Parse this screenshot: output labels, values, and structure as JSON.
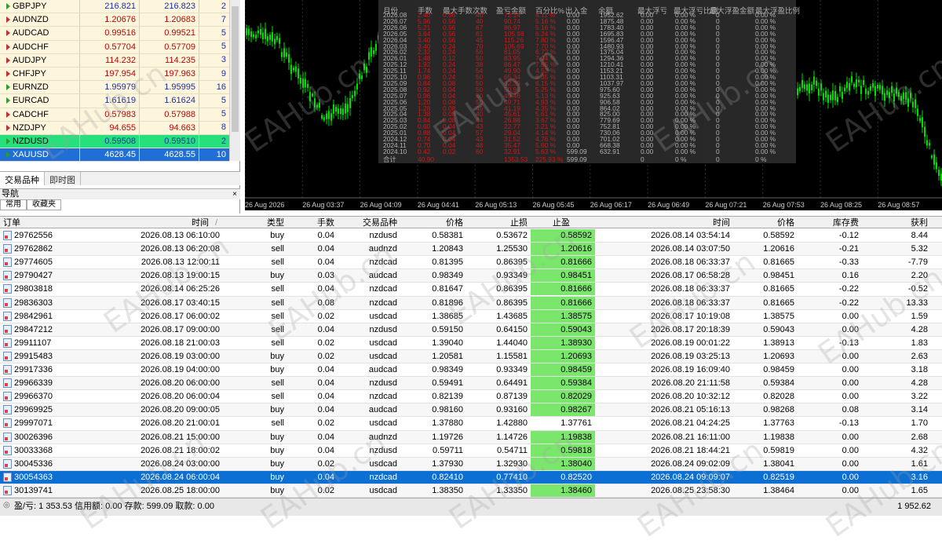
{
  "market_watch": {
    "rows": [
      {
        "symbol": "GBPJPY",
        "bid": "216.821",
        "ask": "216.823",
        "spread": "2",
        "style": "normal",
        "dir": "up"
      },
      {
        "symbol": "AUDNZD",
        "bid": "1.20676",
        "ask": "1.20683",
        "spread": "7",
        "style": "normal",
        "dir": "down"
      },
      {
        "symbol": "AUDCAD",
        "bid": "0.99516",
        "ask": "0.99521",
        "spread": "5",
        "style": "normal",
        "dir": "down"
      },
      {
        "symbol": "AUDCHF",
        "bid": "0.57704",
        "ask": "0.57709",
        "spread": "5",
        "style": "normal",
        "dir": "down"
      },
      {
        "symbol": "AUDJPY",
        "bid": "114.232",
        "ask": "114.235",
        "spread": "3",
        "style": "normal",
        "dir": "down"
      },
      {
        "symbol": "CHFJPY",
        "bid": "197.954",
        "ask": "197.963",
        "spread": "9",
        "style": "normal",
        "dir": "down"
      },
      {
        "symbol": "EURNZD",
        "bid": "1.95979",
        "ask": "1.95995",
        "spread": "16",
        "style": "normal",
        "dir": "up"
      },
      {
        "symbol": "EURCAD",
        "bid": "1.61619",
        "ask": "1.61624",
        "spread": "5",
        "style": "normal",
        "dir": "up"
      },
      {
        "symbol": "CADCHF",
        "bid": "0.57983",
        "ask": "0.57988",
        "spread": "5",
        "style": "normal",
        "dir": "down"
      },
      {
        "symbol": "NZDJPY",
        "bid": "94.655",
        "ask": "94.663",
        "spread": "8",
        "style": "normal",
        "dir": "down"
      },
      {
        "symbol": "NZDUSD",
        "bid": "0.59508",
        "ask": "0.59510",
        "spread": "2",
        "style": "green",
        "dir": "up"
      },
      {
        "symbol": "XAUUSD",
        "bid": "4628.45",
        "ask": "4628.55",
        "spread": "10",
        "style": "blue",
        "dir": "up"
      }
    ],
    "tabs": [
      "交易品种",
      "即时图"
    ]
  },
  "navigator": {
    "title": "导航",
    "close": "×",
    "tabs": [
      "常用",
      "收藏夹"
    ]
  },
  "chart": {
    "x_labels": [
      "26 Aug 2026",
      "26 Aug 03:37",
      "26 Aug 04:09",
      "26 Aug 04:41",
      "26 Aug 05:13",
      "26 Aug 05:45",
      "26 Aug 06:17",
      "26 Aug 06:49",
      "26 Aug 07:21",
      "26 Aug 07:53",
      "26 Aug 08:25",
      "26 Aug 08:57"
    ],
    "colors": {
      "bg": "#000000",
      "candle": "#00e000",
      "grid": "#303030"
    }
  },
  "stats_overlay": {
    "headers": [
      "月份",
      "手数",
      "最大手数次数",
      "盈亏金额",
      "百分比%",
      "出入金",
      "余额",
      "最大浮亏",
      "最大浮亏比例",
      "最大浮盈金额",
      "最大浮盈比例"
    ],
    "rows": [
      [
        "2026.08",
        "2.40",
        "0.56",
        "40",
        "72.14",
        "4.11 %",
        "0.00",
        "1952.62",
        "0.00",
        "0.00 %",
        "0",
        "0.00 %"
      ],
      [
        "2026.07",
        "5.96",
        "0.56",
        "40",
        "90.74",
        "5.16 %",
        "0.00",
        "1875.48",
        "0.00",
        "0.00 %",
        "0",
        "0.00 %"
      ],
      [
        "2026.06",
        "5.21",
        "0.56",
        "67",
        "86.97",
        "5.16 %",
        "0.00",
        "1783.40",
        "0.00",
        "0.00 %",
        "0",
        "0.00 %"
      ],
      [
        "2026.05",
        "3.64",
        "0.56",
        "61",
        "105.98",
        "6.24 %",
        "0.00",
        "1695.83",
        "0.00",
        "0.00 %",
        "0",
        "0.00 %"
      ],
      [
        "2026.04",
        "3.40",
        "0.56",
        "45",
        "115.26",
        "7.80 %",
        "0.00",
        "1596.47",
        "0.00",
        "0.00 %",
        "0",
        "0.00 %"
      ],
      [
        "2026.03",
        "3.40",
        "0.24",
        "70",
        "105.69",
        "7.70 %",
        "0.00",
        "1480.93",
        "0.00",
        "0.00 %",
        "0",
        "0.00 %"
      ],
      [
        "2026.02",
        "2.32",
        "0.24",
        "56",
        "81.05",
        "6.72 %",
        "0.00",
        "1375.04",
        "0.00",
        "0.00 %",
        "0",
        "0.00 %"
      ],
      [
        "2026.01",
        "1.48",
        "0.12",
        "50",
        "83.95",
        "7.04 %",
        "0.00",
        "1294.36",
        "0.00",
        "0.00 %",
        "0",
        "0.00 %"
      ],
      [
        "2025.12",
        "1.92",
        "0.24",
        "38",
        "86.47",
        "7.65 %",
        "0.00",
        "1210.41",
        "0.00",
        "0.00 %",
        "0",
        "0.00 %"
      ],
      [
        "2025.11",
        "1.74",
        "0.24",
        "54",
        "49.90",
        "4.52 %",
        "0.00",
        "1153.21",
        "0.00",
        "0.00 %",
        "0",
        "0.00 %"
      ],
      [
        "2025.10",
        "0.96",
        "0.24",
        "50",
        "65.34",
        "6.35 %",
        "0.00",
        "1103.31",
        "0.00",
        "0.00 %",
        "0",
        "0.00 %"
      ],
      [
        "2025.09",
        "0.84",
        "0.08",
        "50",
        "62.39",
        "6.15 %",
        "0.00",
        "1037.97",
        "0.00",
        "0.00 %",
        "0",
        "0.00 %"
      ],
      [
        "2025.08",
        "0.92",
        "0.04",
        "50",
        "50.96",
        "5.25 %",
        "0.00",
        "975.60",
        "0.00",
        "0.00 %",
        "0",
        "0.00 %"
      ],
      [
        "2025.07",
        "0.96",
        "0.04",
        "50",
        "49.46",
        "5.13 %",
        "0.00",
        "925.63",
        "0.00",
        "0.00 %",
        "0",
        "0.00 %"
      ],
      [
        "2025.06",
        "1.20",
        "0.08",
        "50",
        "49.71",
        "4.93 %",
        "0.00",
        "906.58",
        "0.00",
        "0.00 %",
        "0",
        "0.00 %"
      ],
      [
        "2025.05",
        "1.28",
        "0.08",
        "45",
        "41.19",
        "4.35 %",
        "0.00",
        "864.02",
        "0.00",
        "0.00 %",
        "0",
        "0.00 %"
      ],
      [
        "2025.04",
        "1.38",
        "0.08",
        "40",
        "45.61",
        "5.61 %",
        "0.00",
        "825.00",
        "0.00",
        "0.00 %",
        "0",
        "0.00 %"
      ],
      [
        "2025.03",
        "0.84",
        "0.08",
        "44",
        "26.88",
        "3.67 %",
        "0.00",
        "779.69",
        "0.00",
        "0.00 %",
        "0",
        "0.00 %"
      ],
      [
        "2025.02",
        "0.60",
        "0.04",
        "43",
        "22.77",
        "3.21 %",
        "0.00",
        "752.81",
        "0.00",
        "0.00 %",
        "0",
        "0.00 %"
      ],
      [
        "2025.01",
        "0.88",
        "0.04",
        "57",
        "29.04",
        "4.14 %",
        "0.00",
        "730.06",
        "0.00",
        "0.00 %",
        "0",
        "0.00 %"
      ],
      [
        "2024.12",
        "0.74",
        "0.04",
        "43",
        "31.52",
        "4.76 %",
        "0.00",
        "701.02",
        "0.00",
        "0.00 %",
        "0",
        "0.00 %"
      ],
      [
        "2024.11",
        "0.70",
        "0.04",
        "48",
        "35.47",
        "5.60 %",
        "0.00",
        "668.38",
        "0.00",
        "0.00 %",
        "0",
        "0.00 %"
      ],
      [
        "2024.10",
        "0.42",
        "0.02",
        "60",
        "32.91",
        "5.63 %",
        "599.09",
        "632.91",
        "0.00",
        "0.00 %",
        "0",
        "0.00 %"
      ]
    ],
    "total": [
      "合计",
      "40.90",
      "",
      "",
      "1353.53",
      "225.93 %",
      "599.09",
      "",
      "0",
      "0 %",
      "0",
      "0 %"
    ]
  },
  "trades": {
    "headers": [
      "订单",
      "时间",
      "类型",
      "手数",
      "交易品种",
      "价格",
      "止损",
      "止盈",
      "时间",
      "价格",
      "库存费",
      "获利"
    ],
    "sort_glyph": "/",
    "rows": [
      [
        "29762556",
        "2026.08.13 06:10:00",
        "buy",
        "0.04",
        "nzdusd",
        "0.58381",
        "0.53672",
        "0.58592",
        "2026.08.14 03:54:14",
        "0.58592",
        "-0.12",
        "8.44"
      ],
      [
        "29762862",
        "2026.08.13 06:20:08",
        "sell",
        "0.04",
        "audnzd",
        "1.20843",
        "1.25530",
        "1.20616",
        "2026.08.14 03:07:50",
        "1.20616",
        "-0.21",
        "5.32"
      ],
      [
        "29774605",
        "2026.08.13 12:00:11",
        "sell",
        "0.04",
        "nzdcad",
        "0.81395",
        "0.86395",
        "0.81666",
        "2026.08.18 06:33:37",
        "0.81665",
        "-0.33",
        "-7.79"
      ],
      [
        "29790427",
        "2026.08.13 19:00:15",
        "buy",
        "0.03",
        "audcad",
        "0.98349",
        "0.93349",
        "0.98451",
        "2026.08.17 06:58:28",
        "0.98451",
        "0.16",
        "2.20"
      ],
      [
        "29803818",
        "2026.08.14 06:25:26",
        "sell",
        "0.04",
        "nzdcad",
        "0.81647",
        "0.86395",
        "0.81666",
        "2026.08.18 06:33:37",
        "0.81665",
        "-0.22",
        "-0.52"
      ],
      [
        "29836303",
        "2026.08.17 03:40:15",
        "sell",
        "0.08",
        "nzdcad",
        "0.81896",
        "0.86395",
        "0.81666",
        "2026.08.18 06:33:37",
        "0.81665",
        "-0.22",
        "13.33"
      ],
      [
        "29842961",
        "2026.08.17 06:00:02",
        "sell",
        "0.02",
        "usdcad",
        "1.38685",
        "1.43685",
        "1.38575",
        "2026.08.17 10:19:08",
        "1.38575",
        "0.00",
        "1.59"
      ],
      [
        "29847212",
        "2026.08.17 09:00:00",
        "sell",
        "0.04",
        "nzdusd",
        "0.59150",
        "0.64150",
        "0.59043",
        "2026.08.17 20:18:39",
        "0.59043",
        "0.00",
        "4.28"
      ],
      [
        "29911107",
        "2026.08.18 21:00:03",
        "sell",
        "0.02",
        "usdcad",
        "1.39040",
        "1.44040",
        "1.38930",
        "2026.08.19 00:01:22",
        "1.38913",
        "-0.13",
        "1.83"
      ],
      [
        "29915483",
        "2026.08.19 03:00:00",
        "buy",
        "0.02",
        "usdcad",
        "1.20581",
        "1.15581",
        "1.20693",
        "2026.08.19 03:25:13",
        "1.20693",
        "0.00",
        "2.63"
      ],
      [
        "29917336",
        "2026.08.19 04:00:00",
        "buy",
        "0.04",
        "audcad",
        "0.98349",
        "0.93349",
        "0.98459",
        "2026.08.19 16:09:40",
        "0.98459",
        "0.00",
        "3.18"
      ],
      [
        "29966339",
        "2026.08.20 06:00:00",
        "sell",
        "0.04",
        "nzdusd",
        "0.59491",
        "0.64491",
        "0.59384",
        "2026.08.20 21:11:58",
        "0.59384",
        "0.00",
        "4.28"
      ],
      [
        "29966370",
        "2026.08.20 06:00:04",
        "sell",
        "0.04",
        "nzdcad",
        "0.82139",
        "0.87139",
        "0.82029",
        "2026.08.20 10:32:12",
        "0.82028",
        "0.00",
        "3.22"
      ],
      [
        "29969925",
        "2026.08.20 09:00:05",
        "buy",
        "0.04",
        "audcad",
        "0.98160",
        "0.93160",
        "0.98267",
        "2026.08.21 05:16:13",
        "0.98268",
        "0.08",
        "3.14"
      ],
      [
        "29997071",
        "2026.08.20 21:00:01",
        "sell",
        "0.02",
        "usdcad",
        "1.37880",
        "1.42880",
        "1.37761",
        "2026.08.21 04:24:25",
        "1.37763",
        "-0.13",
        "1.70"
      ],
      [
        "30026396",
        "2026.08.21 15:00:00",
        "buy",
        "0.04",
        "audnzd",
        "1.19726",
        "1.14726",
        "1.19838",
        "2026.08.21 16:11:00",
        "1.19838",
        "0.00",
        "2.68"
      ],
      [
        "30033368",
        "2026.08.21 18:00:02",
        "buy",
        "0.04",
        "nzdusd",
        "0.59711",
        "0.54711",
        "0.59818",
        "2026.08.21 18:44:21",
        "0.59819",
        "0.00",
        "4.32"
      ],
      [
        "30045336",
        "2026.08.24 03:00:00",
        "buy",
        "0.02",
        "usdcad",
        "1.37930",
        "1.32930",
        "1.38040",
        "2026.08.24 09:02:09",
        "1.38041",
        "0.00",
        "1.61"
      ],
      [
        "30054363",
        "2026.08.24 06:00:04",
        "buy",
        "0.04",
        "nzdcad",
        "0.82410",
        "0.77410",
        "0.82520",
        "2026.08.24 09:09:07",
        "0.82519",
        "0.00",
        "3.16"
      ],
      [
        "30139741",
        "2026.08.25 18:00:00",
        "buy",
        "0.02",
        "usdcad",
        "1.38350",
        "1.33350",
        "1.38460",
        "2026.08.25 23:58:30",
        "1.38464",
        "0.00",
        "1.65"
      ]
    ],
    "selected_index": 18,
    "tp_hit": [
      true,
      true,
      true,
      true,
      true,
      true,
      true,
      true,
      true,
      true,
      true,
      true,
      true,
      true,
      false,
      true,
      true,
      true,
      true,
      true
    ]
  },
  "footer": {
    "summary": "盈/亏: 1 353.53  信用额: 0.00  存款: 599.09  取款: 0.00",
    "balance": "1 952.62"
  },
  "watermark": "EAHub.cn"
}
